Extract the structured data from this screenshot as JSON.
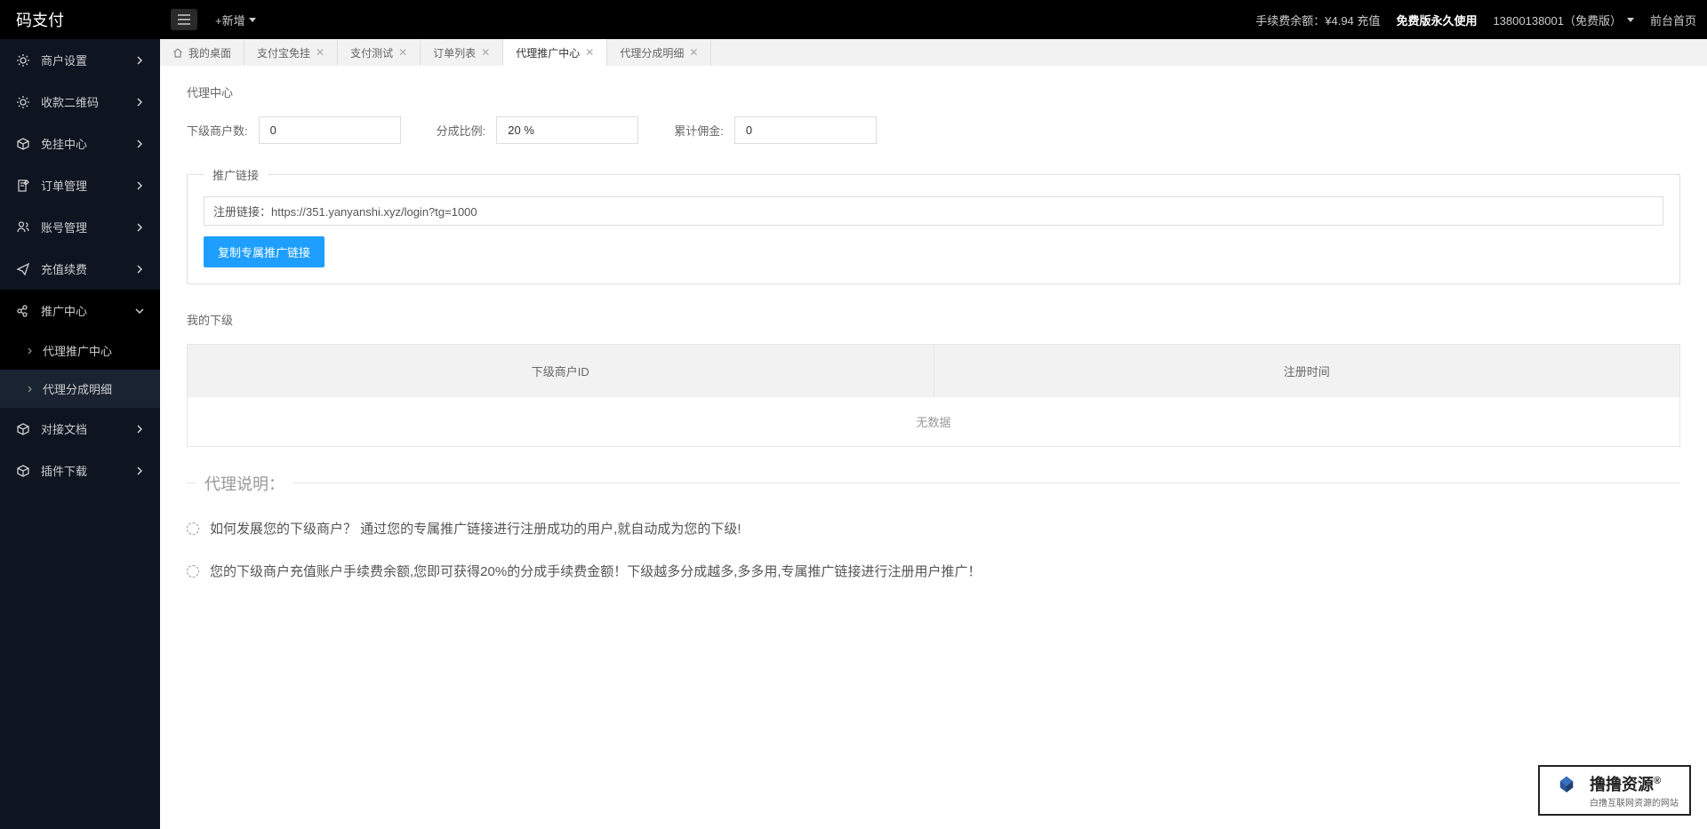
{
  "app_name": "码支付",
  "topbar": {
    "add_label": "+新增",
    "balance_label": "手续费余额：",
    "balance_value": "¥4.94",
    "recharge": "充值",
    "version_info": "免费版永久使用",
    "user_phone": "13800138001（免费版）",
    "front_link": "前台首页"
  },
  "sidebar": {
    "items": [
      {
        "label": "商户设置",
        "icon": "gear"
      },
      {
        "label": "收款二维码",
        "icon": "gear"
      },
      {
        "label": "免挂中心",
        "icon": "cube"
      },
      {
        "label": "订单管理",
        "icon": "edit"
      },
      {
        "label": "账号管理",
        "icon": "users"
      },
      {
        "label": "充值续费",
        "icon": "send"
      },
      {
        "label": "推广中心",
        "icon": "share",
        "expanded": true,
        "children": [
          {
            "label": "代理推广中心",
            "active": true
          },
          {
            "label": "代理分成明细"
          }
        ]
      },
      {
        "label": "对接文档",
        "icon": "cube"
      },
      {
        "label": "插件下载",
        "icon": "cube"
      }
    ]
  },
  "tabs": [
    {
      "label": "我的桌面",
      "home": true
    },
    {
      "label": "支付宝免挂",
      "closable": true
    },
    {
      "label": "支付测试",
      "closable": true
    },
    {
      "label": "订单列表",
      "closable": true
    },
    {
      "label": "代理推广中心",
      "closable": true,
      "active": true
    },
    {
      "label": "代理分成明细",
      "closable": true
    }
  ],
  "page": {
    "section1_title": "代理中心",
    "stats": {
      "merchant_label": "下级商户数:",
      "merchant_value": "0",
      "ratio_label": "分成比例:",
      "ratio_value": "20 %",
      "commission_label": "累计佣金:",
      "commission_value": "0"
    },
    "promo_legend": "推广链接",
    "promo_link": "注册链接：https://351.yanyanshi.xyz/login?tg=1000",
    "copy_btn": "复制专属推广链接",
    "section2_title": "我的下级",
    "table": {
      "col1": "下级商户ID",
      "col2": "注册时间",
      "empty": "无数据"
    },
    "desc_title": "代理说明：",
    "desc_items": [
      "如何发展您的下级商户？ 通过您的专属推广链接进行注册成功的用户,就自动成为您的下级!",
      "您的下级商户充值账户手续费余额,您即可获得20%的分成手续费金额！下级越多分成越多,多多用,专属推广链接进行注册用户推广！"
    ]
  },
  "watermark": {
    "main": "撸撸资源",
    "sub": "白撸互联网资源的网站"
  }
}
